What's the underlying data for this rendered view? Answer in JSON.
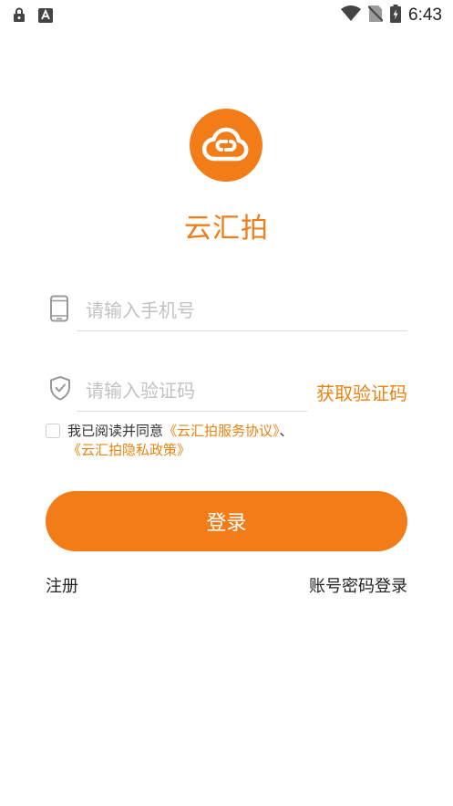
{
  "status_bar": {
    "time": "6:43"
  },
  "app": {
    "name": "云汇拍"
  },
  "phone": {
    "placeholder": "请输入手机号"
  },
  "code": {
    "placeholder": "请输入验证码",
    "get_code_label": "获取验证码"
  },
  "agreement": {
    "prefix": "我已阅读并同意",
    "link_service": "《云汇拍服务协议》",
    "separator": "、",
    "link_privacy": "《云汇拍隐私政策》",
    "checked": false
  },
  "login_button_label": "登录",
  "register_label": "注册",
  "password_login_label": "账号密码登录",
  "colors": {
    "accent": "#f27c18",
    "link": "#e98312"
  }
}
